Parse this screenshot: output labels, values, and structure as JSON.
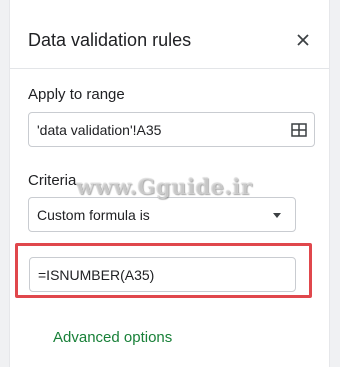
{
  "panel": {
    "title": "Data validation rules",
    "close_icon": "close-icon"
  },
  "apply_range": {
    "label": "Apply to range",
    "value": "'data validation'!A35",
    "icon": "grid-select-icon"
  },
  "criteria": {
    "label": "Criteria",
    "selected": "Custom formula is",
    "icon": "caret-down-icon"
  },
  "formula": {
    "value": "=ISNUMBER(A35)"
  },
  "advanced_options": {
    "label": "Advanced options"
  },
  "watermark": {
    "text": "www.Gguide.ir"
  },
  "colors": {
    "accent_green": "#188038",
    "highlight_red": "#e0474c",
    "border": "#c9ccd1",
    "text": "#202124"
  }
}
